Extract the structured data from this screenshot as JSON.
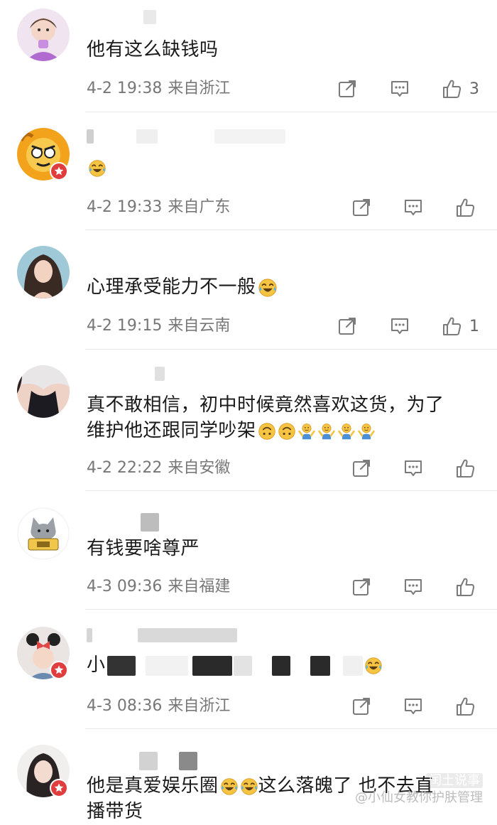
{
  "comments": [
    {
      "text": "他有这么缺钱吗",
      "date": "4-2 19:38",
      "location": "来自浙江",
      "likes": "3",
      "avatar_icon": "girl-purple-avatar-icon"
    },
    {
      "text": "",
      "date": "4-2 19:33",
      "location": "来自广东",
      "likes": "",
      "avatar_icon": "cartoon-monkey-avatar-icon"
    },
    {
      "text": "心理承受能力不一般",
      "date": "4-2 19:15",
      "location": "来自云南",
      "likes": "1",
      "avatar_icon": "woman-photo-avatar-icon"
    },
    {
      "text_line1": "真不敢相信，初中时候竟然喜欢这货，为了",
      "text_line2": "维护他还跟同学吵架",
      "date": "4-2 22:22",
      "location": "来自安徽",
      "likes": "",
      "avatar_icon": "woman-dress-avatar-icon"
    },
    {
      "text": "有钱要啥尊严",
      "date": "4-3 09:36",
      "location": "来自福建",
      "likes": "",
      "avatar_icon": "cat-cartoon-avatar-icon"
    },
    {
      "text_prefix": "小",
      "date": "4-3 08:36",
      "location": "来自浙江",
      "likes": "",
      "avatar_icon": "child-minnie-avatar-icon"
    },
    {
      "text_part1": "他是真爱娱乐圈",
      "text_part2": "这么落魄了 也不去直",
      "text_line2": "播带货",
      "avatar_icon": "woman-selfie-avatar-icon"
    }
  ],
  "watermark": {
    "line1": "闰土说事",
    "line2": "@小仙女教你护肤管理"
  },
  "colors": {
    "badge_red": "#e03e3e",
    "meta_gray": "#777777",
    "divider": "#e7e7e7",
    "emoji_yellow": "#f6c443"
  }
}
